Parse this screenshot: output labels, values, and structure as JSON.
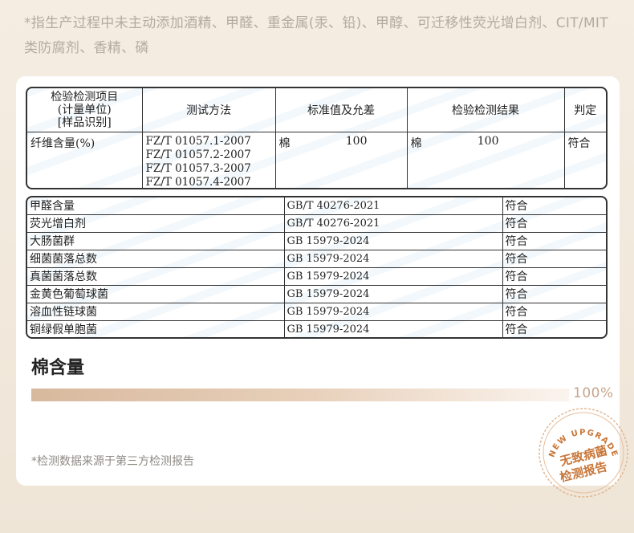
{
  "top_note": "*指生产过程中未主动添加酒精、甲醛、重金属(汞、铅)、甲醇、可迁移性荧光增白剂、CIT/MIT类防腐剂、香精、磷",
  "table1": {
    "headers": {
      "col1_line1": "检验检测项目",
      "col1_line2": "(计量单位)",
      "col1_line3": "[样品识别]",
      "col2": "测试方法",
      "col3": "标准值及允差",
      "col4": "检验检测结果",
      "col5": "判定"
    },
    "row": {
      "item": "纤维含量(%)",
      "methods": [
        "FZ/T 01057.1-2007",
        "FZ/T 01057.2-2007",
        "FZ/T 01057.3-2007",
        "FZ/T 01057.4-2007"
      ],
      "std_name": "棉",
      "std_value": "100",
      "res_name": "棉",
      "res_value": "100",
      "verdict": "符合"
    }
  },
  "table2": {
    "rows": [
      {
        "item": "甲醛含量",
        "standard": "GB/T 40276-2021",
        "verdict": "符合"
      },
      {
        "item": "荧光增白剂",
        "standard": "GB/T 40276-2021",
        "verdict": "符合"
      },
      {
        "item": "大肠菌群",
        "standard": "GB 15979-2024",
        "verdict": "符合"
      },
      {
        "item": "细菌菌落总数",
        "standard": "GB 15979-2024",
        "verdict": "符合"
      },
      {
        "item": "真菌菌落总数",
        "standard": "GB 15979-2024",
        "verdict": "符合"
      },
      {
        "item": "金黄色葡萄球菌",
        "standard": "GB 15979-2024",
        "verdict": "符合"
      },
      {
        "item": "溶血性链球菌",
        "standard": "GB 15979-2024",
        "verdict": "符合"
      },
      {
        "item": "铜绿假单胞菌",
        "standard": "GB 15979-2024",
        "verdict": "符合"
      }
    ]
  },
  "cotton": {
    "title": "棉含量",
    "percent_label": "100%",
    "percent_value": 100
  },
  "bottom_note": "*检测数据来源于第三方检测报告",
  "seal": {
    "arc_text": "NEW UPGRADE",
    "line1": "无致病菌",
    "line2": "检测报告"
  },
  "colors": {
    "bar_start": "#d8b99e",
    "seal": "#c9773a",
    "percent": "#c8a58a"
  }
}
